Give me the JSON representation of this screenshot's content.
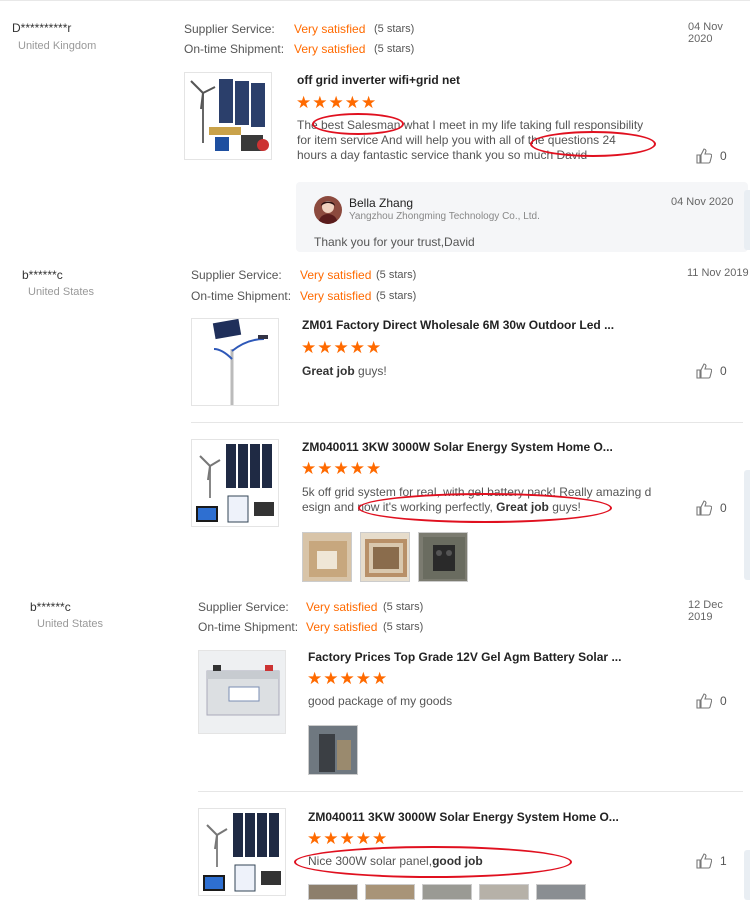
{
  "reviews": [
    {
      "buyer": "D**********r",
      "country": "United Kingdom",
      "supplier_service_label": "Supplier Service:",
      "supplier_service_value": "Very satisfied",
      "supplier_service_stars": "(5 stars)",
      "shipment_label": "On-time Shipment:",
      "shipment_value": "Very satisfied",
      "shipment_stars": "(5 stars)",
      "date": "04 Nov 2020",
      "products": [
        {
          "title": "off grid inverter wifi+grid net",
          "rating": "★★★★★",
          "comment": "The best Salesman what  I meet in my life taking full responsibility for item service And will help you with all of the questions 24 hours a day fantastic service thank you so much David",
          "likes": "0"
        }
      ],
      "reply": {
        "name": "Bella Zhang",
        "company": "Yangzhou Zhongming Technology Co., Ltd.",
        "date": "04 Nov 2020",
        "text": "Thank you for your trust,David"
      }
    },
    {
      "buyer": "b******c",
      "country": "United States",
      "supplier_service_label": "Supplier Service:",
      "supplier_service_value": "Very satisfied",
      "supplier_service_stars": "(5 stars)",
      "shipment_label": "On-time Shipment:",
      "shipment_value": "Very satisfied",
      "shipment_stars": "(5 stars)",
      "date": "11 Nov 2019",
      "products": [
        {
          "title": "ZM01 Factory Direct Wholesale 6M 30w Outdoor Led ...",
          "rating": "★★★★★",
          "comment_bold": "Great job",
          "comment_rest": " guys!",
          "likes": "0"
        },
        {
          "title": "ZM040011 3KW 3000W Solar Energy System Home O...",
          "rating": "★★★★★",
          "comment_line1": "5k off grid system for real, with gel battery pack!  Really amazing d",
          "comment_line2_pre": "esign and now it's working perfectly, ",
          "comment_bold": "Great job",
          "comment_rest": " guys!",
          "likes": "0"
        }
      ]
    },
    {
      "buyer": "b******c",
      "country": "United States",
      "supplier_service_label": "Supplier Service:",
      "supplier_service_value": "Very satisfied",
      "supplier_service_stars": "(5 stars)",
      "shipment_label": "On-time Shipment:",
      "shipment_value": "Very satisfied",
      "shipment_stars": "(5 stars)",
      "date": "12 Dec 2019",
      "products": [
        {
          "title": "Factory Prices Top Grade 12V Gel Agm Battery Solar ...",
          "rating": "★★★★★",
          "comment": "good package of my goods",
          "likes": "0"
        },
        {
          "title": "ZM040011 3KW 3000W Solar Energy System Home O...",
          "rating": "★★★★★",
          "comment_pre": "Nice 300W solar panel,",
          "comment_bold": "good job",
          "likes": "1"
        }
      ]
    }
  ],
  "colors": {
    "accent": "#ff6a00",
    "annotation": "#e0101f"
  },
  "icons": {
    "like": "thumbs-up-icon"
  }
}
